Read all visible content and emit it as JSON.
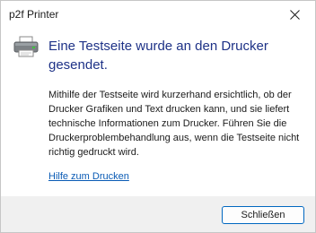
{
  "window": {
    "title": "p2f Printer"
  },
  "dialog": {
    "headline": "Eine Testseite wurde an den Drucker gesendet.",
    "body": "Mithilfe der Testseite wird kurzerhand ersichtlich, ob der Drucker Grafiken und Text drucken kann, und sie liefert technische Informationen zum Drucker. Führen Sie die Druckerproblembehandlung aus, wenn die Testseite nicht richtig gedruckt wird.",
    "help_link": "Hilfe zum Drucken",
    "close_button": "Schließen"
  },
  "icons": {
    "printer": "printer-icon",
    "close": "close-icon"
  },
  "colors": {
    "headline": "#1e3287",
    "link": "#0a5bb5",
    "button_border": "#0067c0",
    "footer_bg": "#f0f0f0"
  }
}
